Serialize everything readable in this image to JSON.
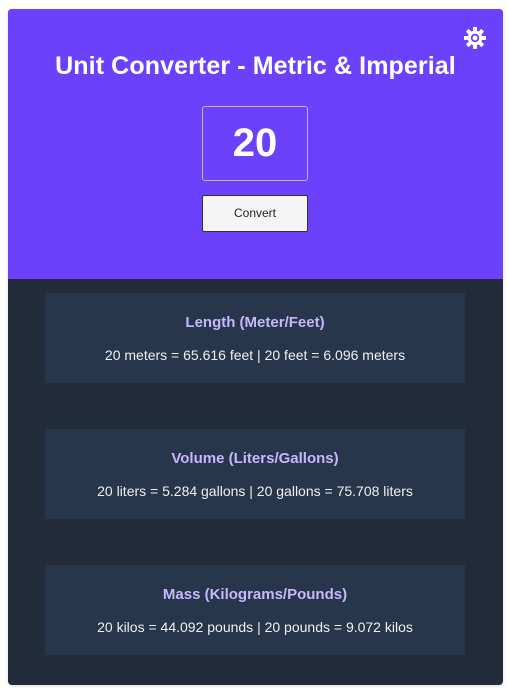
{
  "header": {
    "title": "Unit Converter - Metric & Imperial",
    "input_value": "20",
    "convert_label": "Convert",
    "settings_icon": "gear-icon"
  },
  "results": [
    {
      "title": "Length (Meter/Feet)",
      "text": "20 meters = 65.616 feet | 20 feet = 6.096 meters"
    },
    {
      "title": "Volume (Liters/Gallons)",
      "text": "20 liters = 5.284 gallons | 20 gallons = 75.708 liters"
    },
    {
      "title": "Mass (Kilograms/Pounds)",
      "text": "20 kilos = 44.092 pounds | 20 pounds = 9.072 kilos"
    }
  ],
  "colors": {
    "header_bg": "#6b41fc",
    "body_bg": "#222b3a",
    "panel_bg": "#27364a",
    "panel_title": "#c8b6ff"
  }
}
